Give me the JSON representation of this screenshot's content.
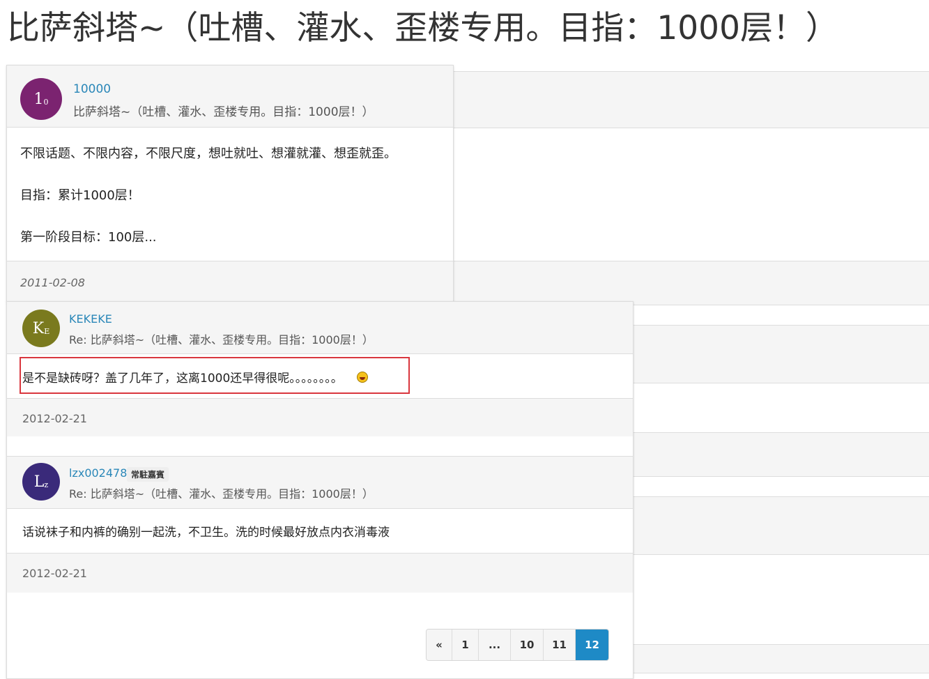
{
  "page": {
    "title": "比萨斜塔~（吐槽、灌水、歪楼专用。目指：1000层！）"
  },
  "posts": [
    {
      "avatar_letter": "1",
      "avatar_sub": "0",
      "avatar_color": "#7b2370",
      "username": "10000",
      "subject": "比萨斜塔~（吐槽、灌水、歪楼专用。目指：1000层！）",
      "body_lines": [
        "不限话题、不限内容，不限尺度，想吐就吐、想灌就灌、想歪就歪。",
        "目指：累计1000层！",
        "第一阶段目标：100层..."
      ],
      "date": "2011-02-08"
    },
    {
      "avatar_letter": "K",
      "avatar_sub": "E",
      "avatar_color": "#7a7a1e",
      "username": "KEKEKE",
      "subject": "Re: 比萨斜塔~（吐槽、灌水、歪楼专用。目指：1000层！）",
      "body": "是不是缺砖呀？盖了几年了，这离1000还早得很呢。。。。。。。。",
      "emoji": "laughing-emoji-icon",
      "date": "2012-02-21"
    },
    {
      "avatar_letter": "L",
      "avatar_sub": "z",
      "avatar_color": "#3a2a7a",
      "username": "lzx002478",
      "badge": "常駐嘉賓",
      "subject": "Re: 比萨斜塔~（吐槽、灌水、歪楼专用。目指：1000层！）",
      "body": "话说袜子和内裤的确别一起洗，不卫生。洗的时候最好放点内衣消毒液",
      "date": "2012-02-21"
    }
  ],
  "pagination": {
    "items": [
      "«",
      "1",
      "...",
      "10",
      "11",
      "12"
    ],
    "active": "12",
    "active_color": "#1e8ac6"
  },
  "colors": {
    "link": "#2a87b8",
    "highlight_border": "#d9363e"
  }
}
